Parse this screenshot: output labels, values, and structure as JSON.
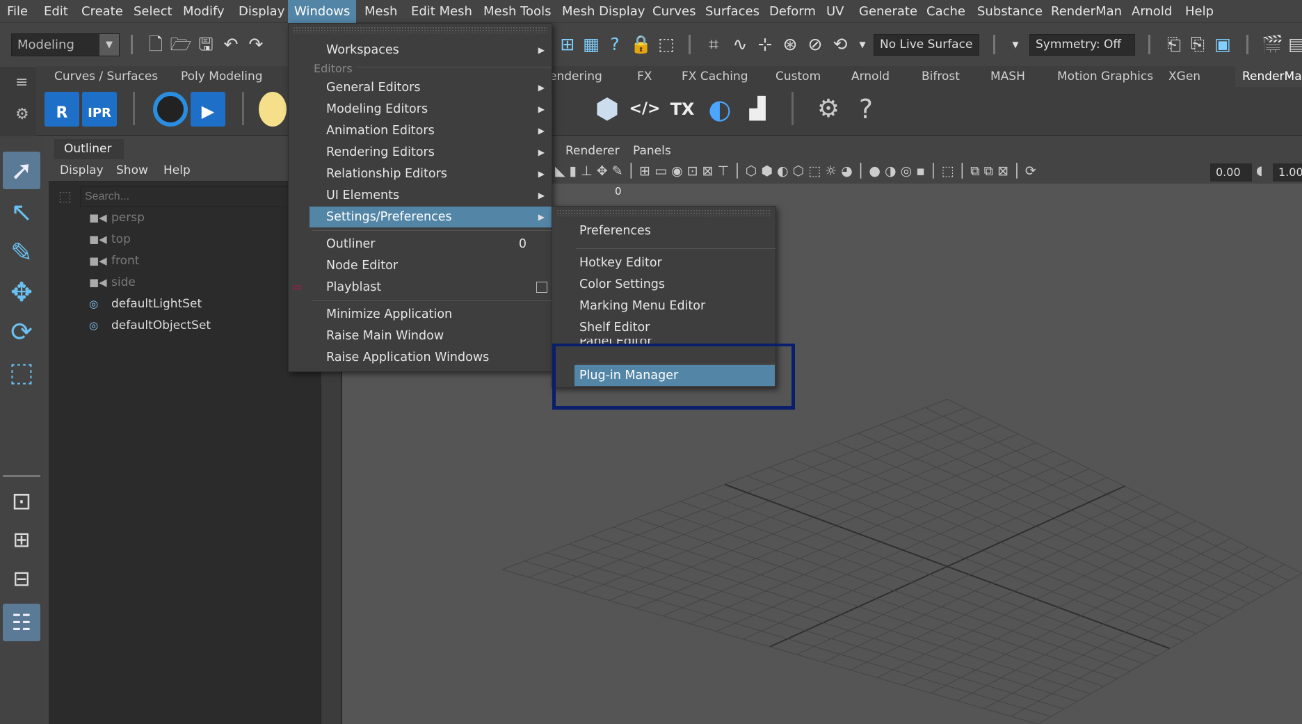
{
  "menubar": {
    "items": [
      "File",
      "Edit",
      "Create",
      "Select",
      "Modify",
      "Display",
      "Windows",
      "Mesh",
      "Edit Mesh",
      "Mesh Tools",
      "Mesh Display",
      "Curves",
      "Surfaces",
      "Deform",
      "UV",
      "Generate",
      "Cache",
      "Substance",
      "RenderMan",
      "Arnold",
      "Help"
    ],
    "active": "Windows"
  },
  "statusline": {
    "workspace": "Modeling",
    "live_surface": "No Live Surface",
    "symmetry": "Symmetry: Off"
  },
  "shelf": {
    "tabs": [
      "Curves / Surfaces",
      "Poly Modeling",
      "endering",
      "FX",
      "FX Caching",
      "Custom",
      "Arnold",
      "Bifrost",
      "MASH",
      "Motion Graphics",
      "XGen",
      "RenderMa"
    ],
    "icons": [
      "renderman-render-icon",
      "renderman-ipr-icon",
      "render-view-icon",
      "playblast-icon",
      "light-icon",
      "package-icon",
      "code-icon",
      "tx-icon",
      "moon-icon",
      "histogram-icon",
      "settings-icon",
      "help-icon"
    ],
    "labels": {
      "r": "R",
      "ipr": "IPR",
      "tx": "TX",
      "code": "</>"
    }
  },
  "outliner": {
    "tab": "Outliner",
    "menu": [
      "Display",
      "Show",
      "Help"
    ],
    "search_placeholder": "Search...",
    "items": [
      {
        "label": "persp",
        "dim": true,
        "icon": "camera-icon"
      },
      {
        "label": "top",
        "dim": true,
        "icon": "camera-icon"
      },
      {
        "label": "front",
        "dim": true,
        "icon": "camera-icon"
      },
      {
        "label": "side",
        "dim": true,
        "icon": "camera-icon"
      },
      {
        "label": "defaultLightSet",
        "dim": false,
        "icon": "set-icon"
      },
      {
        "label": "defaultObjectSet",
        "dim": false,
        "icon": "set-icon"
      }
    ]
  },
  "viewport": {
    "menu": [
      "Renderer",
      "Panels"
    ],
    "frame_label": "0",
    "field1": "0.00",
    "field2": "1.00"
  },
  "windows_menu": {
    "workspaces": "Workspaces",
    "editors_header": "Editors",
    "items": [
      {
        "label": "General Editors",
        "submenu": true
      },
      {
        "label": "Modeling Editors",
        "submenu": true
      },
      {
        "label": "Animation Editors",
        "submenu": true
      },
      {
        "label": "Rendering Editors",
        "submenu": true
      },
      {
        "label": "Relationship Editors",
        "submenu": true
      },
      {
        "label": "UI Elements",
        "submenu": true
      },
      {
        "label": "Settings/Preferences",
        "submenu": true,
        "highlighted": true
      }
    ],
    "outliner": "Outliner",
    "outliner_value": "0",
    "node_editor": "Node Editor",
    "playblast": "Playblast",
    "minimize": "Minimize Application",
    "raise_main": "Raise Main Window",
    "raise_app": "Raise Application Windows"
  },
  "settings_submenu": {
    "items": [
      "Preferences",
      "Hotkey Editor",
      "Color Settings",
      "Marking Menu Editor",
      "Shelf Editor",
      "Panel Editor",
      "Plug-in Manager"
    ],
    "highlighted": "Plug-in Manager"
  },
  "colors": {
    "highlight": "#5285a6",
    "annotation_box": "#0a1f6b"
  }
}
